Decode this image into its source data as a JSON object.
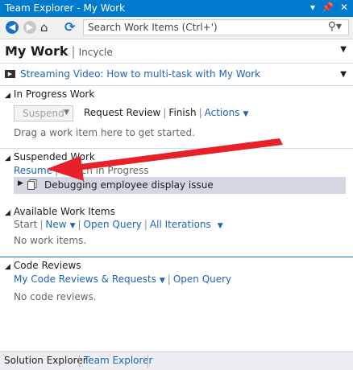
{
  "window": {
    "title": "Team Explorer - My Work",
    "pin_icon": "pin-icon",
    "close_icon": "close-icon"
  },
  "toolbar": {
    "search_placeholder": "Search Work Items (Ctrl+')"
  },
  "header": {
    "title": "My Work",
    "project": "Incycle"
  },
  "video": {
    "label": "Streaming Video: How to multi-task with My Work"
  },
  "in_progress": {
    "title": "In Progress Work",
    "suspend_label": "Suspend",
    "request_review": "Request Review",
    "finish": "Finish",
    "actions": "Actions",
    "empty_text": "Drag a work item here to get started."
  },
  "suspended": {
    "title": "Suspended Work",
    "resume": "Resume",
    "switch": "Switch in Progress",
    "items": [
      {
        "label": "Debugging employee display issue"
      }
    ]
  },
  "available": {
    "title": "Available Work Items",
    "start": "Start",
    "new": "New",
    "open_query": "Open Query",
    "all_iterations": "All Iterations",
    "empty_text": "No work items."
  },
  "code_reviews": {
    "title": "Code Reviews",
    "my_reviews": "My Code Reviews & Requests",
    "open_query": "Open Query",
    "empty_text": "No code reviews."
  },
  "bottom_tabs": [
    {
      "label": "Solution Explorer"
    },
    {
      "label": "Team Explorer"
    }
  ],
  "colors": {
    "accent": "#007acc",
    "link": "#1c64b4",
    "annotation_arrow": "#e8202a"
  }
}
